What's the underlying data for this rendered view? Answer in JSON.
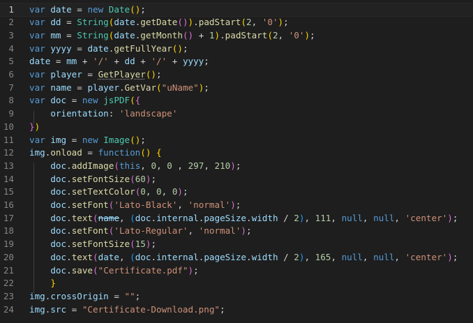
{
  "editor": {
    "current_line": 1,
    "lines": [
      {
        "n": "1",
        "t": [
          [
            "k",
            "var "
          ],
          [
            "v",
            "date"
          ],
          [
            "p",
            " = "
          ],
          [
            "k",
            "new "
          ],
          [
            "c",
            "Date"
          ],
          [
            "b1",
            "()"
          ],
          [
            "p",
            ";"
          ]
        ]
      },
      {
        "n": "2",
        "t": [
          [
            "k",
            "var "
          ],
          [
            "v",
            "dd"
          ],
          [
            "p",
            " = "
          ],
          [
            "c",
            "String"
          ],
          [
            "b1",
            "("
          ],
          [
            "v",
            "date"
          ],
          [
            "p",
            "."
          ],
          [
            "f",
            "getDate"
          ],
          [
            "b2",
            "()"
          ],
          [
            "b1",
            ")"
          ],
          [
            "p",
            "."
          ],
          [
            "f",
            "padStart"
          ],
          [
            "b1",
            "("
          ],
          [
            "n",
            "2"
          ],
          [
            "p",
            ", "
          ],
          [
            "s",
            "'0'"
          ],
          [
            "b1",
            ")"
          ],
          [
            "p",
            ";"
          ]
        ]
      },
      {
        "n": "3",
        "t": [
          [
            "k",
            "var "
          ],
          [
            "v",
            "mm"
          ],
          [
            "p",
            " = "
          ],
          [
            "c",
            "String"
          ],
          [
            "b1",
            "("
          ],
          [
            "v",
            "date"
          ],
          [
            "p",
            "."
          ],
          [
            "f",
            "getMonth"
          ],
          [
            "b2",
            "()"
          ],
          [
            "p",
            " + "
          ],
          [
            "n",
            "1"
          ],
          [
            "b1",
            ")"
          ],
          [
            "p",
            "."
          ],
          [
            "f",
            "padStart"
          ],
          [
            "b1",
            "("
          ],
          [
            "n",
            "2"
          ],
          [
            "p",
            ", "
          ],
          [
            "s",
            "'0'"
          ],
          [
            "b1",
            ")"
          ],
          [
            "p",
            ";"
          ]
        ]
      },
      {
        "n": "4",
        "t": [
          [
            "k",
            "var "
          ],
          [
            "v",
            "yyyy"
          ],
          [
            "p",
            " = "
          ],
          [
            "v",
            "date"
          ],
          [
            "p",
            "."
          ],
          [
            "f",
            "getFullYear"
          ],
          [
            "b1",
            "()"
          ],
          [
            "p",
            ";"
          ]
        ]
      },
      {
        "n": "5",
        "t": [
          [
            "v",
            "date"
          ],
          [
            "p",
            " = "
          ],
          [
            "v",
            "mm"
          ],
          [
            "p",
            " + "
          ],
          [
            "s",
            "'/'"
          ],
          [
            "p",
            " + "
          ],
          [
            "v",
            "dd"
          ],
          [
            "p",
            " + "
          ],
          [
            "s",
            "'/'"
          ],
          [
            "p",
            " + "
          ],
          [
            "v",
            "yyyy"
          ],
          [
            "p",
            ";"
          ]
        ]
      },
      {
        "n": "6",
        "t": [
          [
            "k",
            "var "
          ],
          [
            "v",
            "player"
          ],
          [
            "p",
            " = "
          ],
          [
            "f squig",
            "GetPlayer"
          ],
          [
            "b1",
            "()"
          ],
          [
            "p",
            ";"
          ]
        ]
      },
      {
        "n": "7",
        "t": [
          [
            "k",
            "var "
          ],
          [
            "v",
            "name"
          ],
          [
            "p",
            " = "
          ],
          [
            "v",
            "player"
          ],
          [
            "p",
            "."
          ],
          [
            "f",
            "GetVar"
          ],
          [
            "b1",
            "("
          ],
          [
            "s",
            "\"uName\""
          ],
          [
            "b1",
            ")"
          ],
          [
            "p",
            ";"
          ]
        ]
      },
      {
        "n": "8",
        "t": [
          [
            "k",
            "var "
          ],
          [
            "v",
            "doc"
          ],
          [
            "p",
            " = "
          ],
          [
            "k",
            "new "
          ],
          [
            "c",
            "jsPDF"
          ],
          [
            "b1",
            "("
          ],
          [
            "b2",
            "{"
          ]
        ]
      },
      {
        "n": "9",
        "t": [
          [
            "p",
            "    "
          ],
          [
            "v",
            "orientation"
          ],
          [
            "p",
            ": "
          ],
          [
            "s",
            "'landscape'"
          ]
        ]
      },
      {
        "n": "10",
        "t": [
          [
            "b2",
            "}"
          ],
          [
            "b1",
            ")"
          ]
        ]
      },
      {
        "n": "11",
        "t": [
          [
            "k",
            "var "
          ],
          [
            "v",
            "img"
          ],
          [
            "p",
            " = "
          ],
          [
            "k",
            "new "
          ],
          [
            "c",
            "Image"
          ],
          [
            "b1",
            "()"
          ],
          [
            "p",
            ";"
          ]
        ]
      },
      {
        "n": "12",
        "t": [
          [
            "v",
            "img"
          ],
          [
            "p",
            "."
          ],
          [
            "f",
            "onload"
          ],
          [
            "p",
            " = "
          ],
          [
            "k",
            "function"
          ],
          [
            "b1",
            "()"
          ],
          [
            "p",
            " "
          ],
          [
            "b1",
            "{"
          ]
        ]
      },
      {
        "n": "13",
        "t": [
          [
            "p",
            "    "
          ],
          [
            "v",
            "doc"
          ],
          [
            "p",
            "."
          ],
          [
            "f",
            "addImage"
          ],
          [
            "b2",
            "("
          ],
          [
            "k",
            "this"
          ],
          [
            "p",
            ", "
          ],
          [
            "n",
            "0"
          ],
          [
            "p",
            ", "
          ],
          [
            "n",
            "0"
          ],
          [
            "p",
            " , "
          ],
          [
            "n",
            "297"
          ],
          [
            "p",
            ", "
          ],
          [
            "n",
            "210"
          ],
          [
            "b2",
            ")"
          ],
          [
            "p",
            ";"
          ]
        ]
      },
      {
        "n": "14",
        "t": [
          [
            "p",
            "    "
          ],
          [
            "v",
            "doc"
          ],
          [
            "p",
            "."
          ],
          [
            "f",
            "setFontSize"
          ],
          [
            "b2",
            "("
          ],
          [
            "n",
            "60"
          ],
          [
            "b2",
            ")"
          ],
          [
            "p",
            ";"
          ]
        ]
      },
      {
        "n": "15",
        "t": [
          [
            "p",
            "    "
          ],
          [
            "v",
            "doc"
          ],
          [
            "p",
            "."
          ],
          [
            "f",
            "setTextColor"
          ],
          [
            "b2",
            "("
          ],
          [
            "n",
            "0"
          ],
          [
            "p",
            ", "
          ],
          [
            "n",
            "0"
          ],
          [
            "p",
            ", "
          ],
          [
            "n",
            "0"
          ],
          [
            "b2",
            ")"
          ],
          [
            "p",
            ";"
          ]
        ]
      },
      {
        "n": "16",
        "t": [
          [
            "p",
            "    "
          ],
          [
            "v",
            "doc"
          ],
          [
            "p",
            "."
          ],
          [
            "f",
            "setFont"
          ],
          [
            "b2",
            "("
          ],
          [
            "s",
            "'Lato-Black'"
          ],
          [
            "p",
            ", "
          ],
          [
            "s",
            "'normal'"
          ],
          [
            "b2",
            ")"
          ],
          [
            "p",
            ";"
          ]
        ]
      },
      {
        "n": "17",
        "t": [
          [
            "p",
            "    "
          ],
          [
            "v",
            "doc"
          ],
          [
            "p",
            "."
          ],
          [
            "f",
            "text"
          ],
          [
            "b2",
            "("
          ],
          [
            "v strike",
            "name"
          ],
          [
            "p",
            ", "
          ],
          [
            "b3",
            "("
          ],
          [
            "v",
            "doc"
          ],
          [
            "p",
            "."
          ],
          [
            "v",
            "internal"
          ],
          [
            "p",
            "."
          ],
          [
            "v",
            "pageSize"
          ],
          [
            "p",
            "."
          ],
          [
            "v",
            "width"
          ],
          [
            "p",
            " / "
          ],
          [
            "n",
            "2"
          ],
          [
            "b3",
            ")"
          ],
          [
            "p",
            ", "
          ],
          [
            "n",
            "111"
          ],
          [
            "p",
            ", "
          ],
          [
            "k",
            "null"
          ],
          [
            "p",
            ", "
          ],
          [
            "k",
            "null"
          ],
          [
            "p",
            ", "
          ],
          [
            "s",
            "'center'"
          ],
          [
            "b2",
            ")"
          ],
          [
            "p",
            ";"
          ]
        ]
      },
      {
        "n": "18",
        "t": [
          [
            "p",
            "    "
          ],
          [
            "v",
            "doc"
          ],
          [
            "p",
            "."
          ],
          [
            "f",
            "setFont"
          ],
          [
            "b2",
            "("
          ],
          [
            "s",
            "'Lato-Regular'"
          ],
          [
            "p",
            ", "
          ],
          [
            "s",
            "'normal'"
          ],
          [
            "b2",
            ")"
          ],
          [
            "p",
            ";"
          ]
        ]
      },
      {
        "n": "19",
        "t": [
          [
            "p",
            "    "
          ],
          [
            "v",
            "doc"
          ],
          [
            "p",
            "."
          ],
          [
            "f",
            "setFontSize"
          ],
          [
            "b2",
            "("
          ],
          [
            "n",
            "15"
          ],
          [
            "b2",
            ")"
          ],
          [
            "p",
            ";"
          ]
        ]
      },
      {
        "n": "20",
        "t": [
          [
            "p",
            "    "
          ],
          [
            "v",
            "doc"
          ],
          [
            "p",
            "."
          ],
          [
            "f",
            "text"
          ],
          [
            "b2",
            "("
          ],
          [
            "v",
            "date"
          ],
          [
            "p",
            ", "
          ],
          [
            "b3",
            "("
          ],
          [
            "v",
            "doc"
          ],
          [
            "p",
            "."
          ],
          [
            "v",
            "internal"
          ],
          [
            "p",
            "."
          ],
          [
            "v",
            "pageSize"
          ],
          [
            "p",
            "."
          ],
          [
            "v",
            "width"
          ],
          [
            "p",
            " / "
          ],
          [
            "n",
            "2"
          ],
          [
            "b3",
            ")"
          ],
          [
            "p",
            ", "
          ],
          [
            "n",
            "165"
          ],
          [
            "p",
            ", "
          ],
          [
            "k",
            "null"
          ],
          [
            "p",
            ", "
          ],
          [
            "k",
            "null"
          ],
          [
            "p",
            ", "
          ],
          [
            "s",
            "'center'"
          ],
          [
            "b2",
            ")"
          ],
          [
            "p",
            ";"
          ]
        ]
      },
      {
        "n": "21",
        "t": [
          [
            "p",
            "    "
          ],
          [
            "v",
            "doc"
          ],
          [
            "p",
            "."
          ],
          [
            "f",
            "save"
          ],
          [
            "b2",
            "("
          ],
          [
            "s",
            "\"Certificate.pdf\""
          ],
          [
            "b2",
            ")"
          ],
          [
            "p",
            ";"
          ]
        ]
      },
      {
        "n": "22",
        "t": [
          [
            "p",
            "    "
          ],
          [
            "b1",
            "}"
          ]
        ]
      },
      {
        "n": "23",
        "t": [
          [
            "v",
            "img"
          ],
          [
            "p",
            "."
          ],
          [
            "v",
            "crossOrigin"
          ],
          [
            "p",
            " = "
          ],
          [
            "s",
            "\"\""
          ],
          [
            "p",
            ";"
          ]
        ]
      },
      {
        "n": "24",
        "t": [
          [
            "v",
            "img"
          ],
          [
            "p",
            "."
          ],
          [
            "v",
            "src"
          ],
          [
            "p",
            " = "
          ],
          [
            "s",
            "\"Certificate-Download.png\""
          ],
          [
            "p",
            ";"
          ]
        ]
      }
    ]
  }
}
